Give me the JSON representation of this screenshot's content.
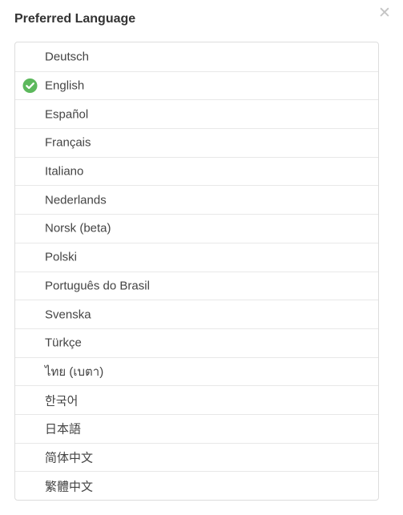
{
  "dialog": {
    "title": "Preferred Language",
    "close_symbol": "✕",
    "close_icon": "close-icon"
  },
  "languages": {
    "selected_index": 1,
    "check_icon": "check-circle-icon",
    "check_color": "#5cb85c",
    "items": [
      {
        "label": "Deutsch"
      },
      {
        "label": "English"
      },
      {
        "label": "Español"
      },
      {
        "label": "Français"
      },
      {
        "label": "Italiano"
      },
      {
        "label": "Nederlands"
      },
      {
        "label": "Norsk (beta)"
      },
      {
        "label": "Polski"
      },
      {
        "label": "Português do Brasil"
      },
      {
        "label": "Svenska"
      },
      {
        "label": "Türkçe"
      },
      {
        "label": "ไทย (เบตา)"
      },
      {
        "label": "한국어"
      },
      {
        "label": "日本語"
      },
      {
        "label": "简体中文"
      },
      {
        "label": "繁體中文"
      }
    ]
  }
}
